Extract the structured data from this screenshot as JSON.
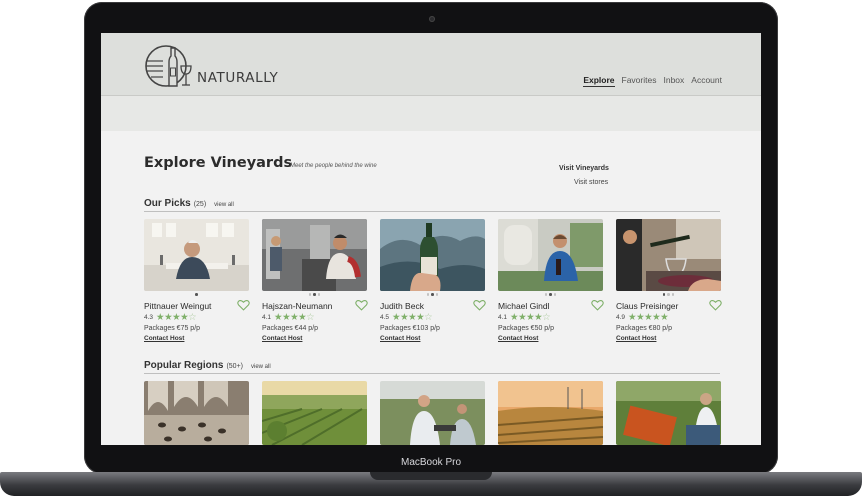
{
  "device": {
    "model_label": "MacBook Pro"
  },
  "header": {
    "logo_text": "NATURALLY",
    "nav": [
      {
        "label": "Explore",
        "active": true
      },
      {
        "label": "Favorites",
        "active": false
      },
      {
        "label": "Inbox",
        "active": false
      },
      {
        "label": "Account",
        "active": false
      }
    ]
  },
  "subnav": {
    "visit_vineyards": "Visit Vineyards",
    "visit_stores": "Visit stores"
  },
  "page": {
    "title": "Explore Vineyards",
    "subtitle": "Meet the people behind the wine"
  },
  "our_picks": {
    "title": "Our Picks",
    "count": "(25)",
    "view_all": "view all",
    "cards": [
      {
        "name": "Pittnauer Weingut",
        "rating": "4.3",
        "stars_filled": 4,
        "packages": "Packages €75 p/p",
        "contact": "Contact Host"
      },
      {
        "name": "Hajszan-Neumann",
        "rating": "4.1",
        "stars_filled": 4,
        "packages": "Packages €44 p/p",
        "contact": "Contact Host"
      },
      {
        "name": "Judith Beck",
        "rating": "4.5",
        "stars_filled": 4,
        "packages": "Packages €103 p/p",
        "contact": "Contact Host"
      },
      {
        "name": "Michael Gindl",
        "rating": "4.1",
        "stars_filled": 4,
        "packages": "Packages €50 p/p",
        "contact": "Contact Host"
      },
      {
        "name": "Claus Preisinger",
        "rating": "4.9",
        "stars_filled": 5,
        "packages": "Packages €80 p/p",
        "contact": "Contact Host"
      }
    ]
  },
  "popular_regions": {
    "title": "Popular Regions",
    "count": "(50+)",
    "view_all": "view all"
  },
  "colors": {
    "accent_green": "#7fb069",
    "header_bg": "#dddfdc",
    "page_bg": "#f2f2f2"
  },
  "icons": [
    "wine-bottle-logo-icon",
    "heart-icon",
    "star-icon"
  ]
}
